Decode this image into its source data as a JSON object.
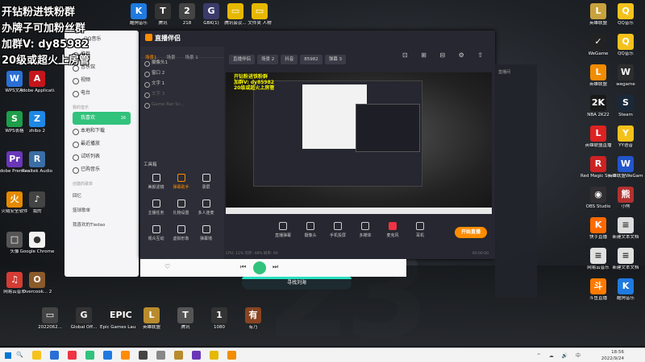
{
  "overlay": {
    "line1": "开钻粉进铁粉群",
    "line2": "办牌子可加粉丝群",
    "line3": "加群V: dy85982",
    "line4": "20级或超火上房管"
  },
  "desktop_icons_left": [
    {
      "label": "WPS文字",
      "color": "#2b6fd6",
      "glyph": "W"
    },
    {
      "label": "Adobe Applicati...",
      "color": "#c4161c",
      "glyph": "A"
    },
    {
      "label": "WPS表格",
      "color": "#1e9e4a",
      "glyph": "S"
    },
    {
      "label": "zhibo 2",
      "color": "#1e88e5",
      "glyph": "Z"
    },
    {
      "label": "Adobe Premier...",
      "color": "#6a36b8",
      "glyph": "Pr"
    },
    {
      "label": "Realtek Audio",
      "color": "#3a6ea5",
      "glyph": "R"
    },
    {
      "label": "火绒安全软件",
      "color": "#e58a00",
      "glyph": "火"
    },
    {
      "label": "我的",
      "color": "#444444",
      "glyph": "♪"
    },
    {
      "label": "头像",
      "color": "#555555",
      "glyph": "□"
    },
    {
      "label": "Google Chrome",
      "color": "#f2f2f2",
      "glyph": "●"
    },
    {
      "label": "网易云音乐",
      "color": "#d43c33",
      "glyph": "♫"
    },
    {
      "label": "Overcook... 2",
      "color": "#8b5a2b",
      "glyph": "O"
    }
  ],
  "desktop_icons_top": [
    {
      "label": "酷狗音乐",
      "color": "#1f7ae0",
      "glyph": "K"
    },
    {
      "label": "腾讯",
      "color": "#333333",
      "glyph": "T"
    },
    {
      "label": "218",
      "color": "#444444",
      "glyph": "2"
    },
    {
      "label": "GBK(1)",
      "color": "#3b3b6b",
      "glyph": "G"
    },
    {
      "label": "腾讯会议...",
      "color": "#e6b800",
      "glyph": "▭"
    },
    {
      "label": "文件夹 人物",
      "color": "#e6b800",
      "glyph": "▭"
    }
  ],
  "desktop_icons_bottom": [
    {
      "label": "2022062...",
      "color": "#444444",
      "glyph": "▭"
    },
    {
      "label": "Global Off...",
      "color": "#333333",
      "glyph": "G"
    },
    {
      "label": "Epic Games Launcher",
      "color": "#222222",
      "glyph": "EPIC"
    },
    {
      "label": "英雄联盟",
      "color": "#b88b2c",
      "glyph": "L"
    },
    {
      "label": "腾讯",
      "color": "#555555",
      "glyph": "T"
    },
    {
      "label": "1080",
      "color": "#333333",
      "glyph": "1"
    },
    {
      "label": "有乃",
      "color": "#884422",
      "glyph": "有"
    }
  ],
  "desktop_icons_right": [
    {
      "label": "英雄联盟",
      "color": "#c8a23c",
      "glyph": "L"
    },
    {
      "label": "QQ音乐",
      "color": "#f4c21b",
      "glyph": "Q"
    },
    {
      "label": "WeGame",
      "color": "#222222",
      "glyph": "✓"
    },
    {
      "label": "QQ音乐",
      "color": "#f4c21b",
      "glyph": "Q"
    },
    {
      "label": "英雄联盟",
      "color": "#f28c00",
      "glyph": "L"
    },
    {
      "label": "wegame",
      "color": "#2d2d2d",
      "glyph": "W"
    },
    {
      "label": "NBA 2K22",
      "color": "#1a1a1a",
      "glyph": "2K"
    },
    {
      "label": "Steam",
      "color": "#1b2838",
      "glyph": "S"
    },
    {
      "label": "英雄联盟直播",
      "color": "#d22",
      "glyph": "L"
    },
    {
      "label": "YY语音",
      "color": "#f4c21b",
      "glyph": "Y"
    },
    {
      "label": "Red Magic Studio",
      "color": "#cc2222",
      "glyph": "R"
    },
    {
      "label": "英雄联盟WeGame",
      "color": "#2255cc",
      "glyph": "W"
    },
    {
      "label": "OBS Studio",
      "color": "#302e31",
      "glyph": "◉"
    },
    {
      "label": "小熊",
      "color": "#b2312f",
      "glyph": "熊"
    },
    {
      "label": "快手直播",
      "color": "#ff6a00",
      "glyph": "K"
    },
    {
      "label": "新建文本文档",
      "color": "#dddddd",
      "glyph": "≡"
    },
    {
      "label": "网易云音乐",
      "color": "#e1e1e1",
      "glyph": "≡"
    },
    {
      "label": "新建文本文档",
      "color": "#e1e1e1",
      "glyph": "≡"
    },
    {
      "label": "斗鱼直播",
      "color": "#ff7a00",
      "glyph": "斗"
    },
    {
      "label": "酷狗音乐",
      "color": "#1f7ae0",
      "glyph": "K"
    }
  ],
  "music": {
    "title": "QQ音乐",
    "items": [
      "推荐",
      "音乐馆",
      "视频",
      "电台"
    ],
    "section_mine": "我的音乐",
    "mine": [
      "我喜欢",
      "本地和下载",
      "最近播放",
      "试听列表",
      "已购音乐"
    ],
    "mine_active_count": "16",
    "section_created": "创建的歌单",
    "playlists": [
      "回忆",
      "篮球歌单",
      "我喜欢的Tiedao"
    ]
  },
  "app": {
    "name": "直播伴侣",
    "tabs": [
      "场景1",
      "场景",
      "场景 1"
    ],
    "sources": [
      "摄像头1",
      "窗口 2",
      "文字 1",
      "文字 3",
      "Game Bar Sc..."
    ],
    "tools_title": "工具箱",
    "tools": [
      "美颜滤镜",
      "弹幕助手",
      "录屏",
      "主播任务",
      "礼物设置",
      "多人连麦",
      "观众互动",
      "虚拟形象",
      "弹幕墙"
    ],
    "toolbar": [
      "直播伴侣",
      "场景 2",
      "抖音",
      "85982",
      "弹幕 3"
    ],
    "top_icons": "⊡ ⊞ ⊟ ⚙ ⇧",
    "controls": [
      {
        "label": "直播弹幕",
        "red": false
      },
      {
        "label": "摄像头",
        "red": false
      },
      {
        "label": "手机投屏",
        "red": false
      },
      {
        "label": "多媒体",
        "red": false
      },
      {
        "label": "麦克风",
        "red": true
      },
      {
        "label": "耳机",
        "red": false
      }
    ],
    "go_live": "开始直播",
    "status_left": "CPU: 12%   内存: 48%   帧率: 60",
    "status_right": "00:00:00"
  },
  "nested_overlay": "开钻粉进铁粉群\n加群V: dy85982\n20级或超火上房管",
  "rpanel_title": "直播间",
  "player": {
    "prev": "⏮",
    "next": "⏭",
    "like": "♡",
    "lyric": "寻找刘海"
  },
  "taskbar": {
    "search": "🔍",
    "tray": "^ ☁ 🔊 中",
    "time": "18:56",
    "date": "2022/9/24"
  },
  "colors": {
    "accent": "#ff8c00",
    "music_green": "#31c27c"
  }
}
